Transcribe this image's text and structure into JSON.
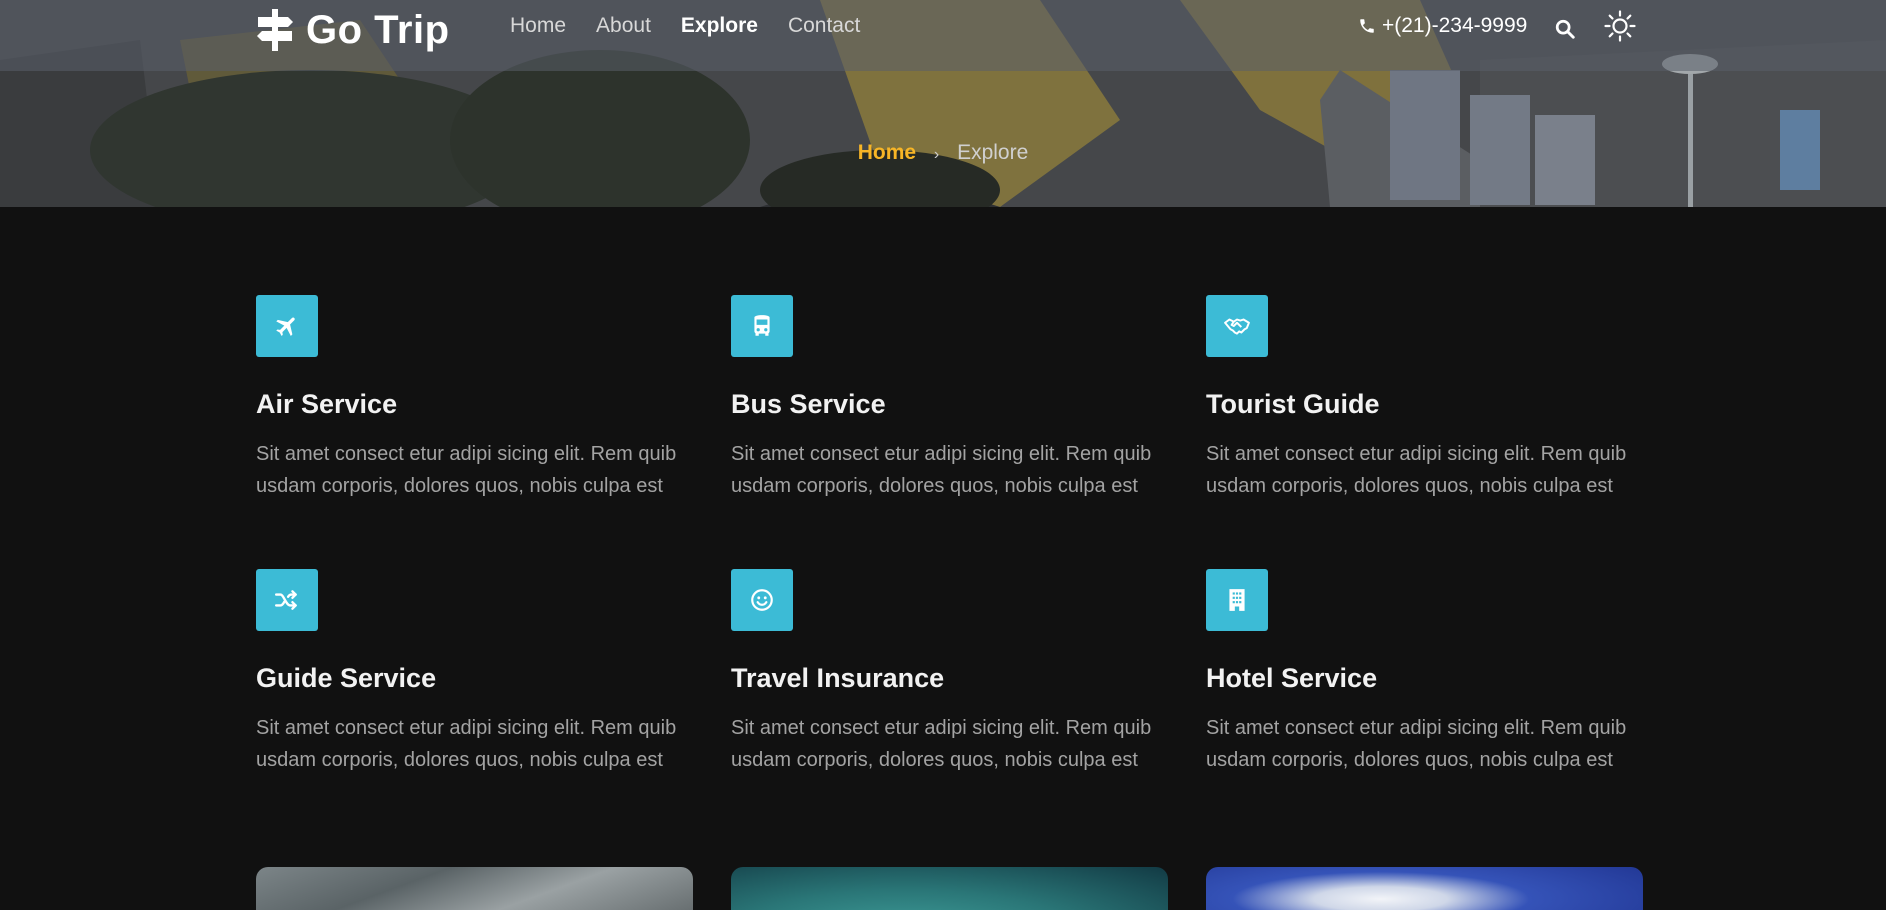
{
  "brand": {
    "name": "Go Trip"
  },
  "nav": {
    "items": [
      {
        "label": "Home",
        "active": false
      },
      {
        "label": "About",
        "active": false
      },
      {
        "label": "Explore",
        "active": true
      },
      {
        "label": "Contact",
        "active": false
      }
    ]
  },
  "header": {
    "phone": "+(21)-234-9999",
    "search_icon": "search-icon",
    "theme_icon": "sun-icon"
  },
  "breadcrumb": {
    "home": "Home",
    "separator": "›",
    "current": "Explore"
  },
  "colors": {
    "accent": "#3cbbd6",
    "breadcrumb_active": "#f7b526",
    "background": "#111111"
  },
  "services": [
    {
      "icon": "plane-icon",
      "title": "Air Service",
      "description": "Sit amet consect etur adipi sicing elit. Rem quib usdam corporis, dolores quos, nobis culpa est"
    },
    {
      "icon": "bus-icon",
      "title": "Bus Service",
      "description": "Sit amet consect etur adipi sicing elit. Rem quib usdam corporis, dolores quos, nobis culpa est"
    },
    {
      "icon": "handshake-icon",
      "title": "Tourist Guide",
      "description": "Sit amet consect etur adipi sicing elit. Rem quib usdam corporis, dolores quos, nobis culpa est"
    },
    {
      "icon": "shuffle-icon",
      "title": "Guide Service",
      "description": "Sit amet consect etur adipi sicing elit. Rem quib usdam corporis, dolores quos, nobis culpa est"
    },
    {
      "icon": "smile-icon",
      "title": "Travel Insurance",
      "description": "Sit amet consect etur adipi sicing elit. Rem quib usdam corporis, dolores quos, nobis culpa est"
    },
    {
      "icon": "building-icon",
      "title": "Hotel Service",
      "description": "Sit amet consect etur adipi sicing elit. Rem quib usdam corporis, dolores quos, nobis culpa est"
    }
  ]
}
